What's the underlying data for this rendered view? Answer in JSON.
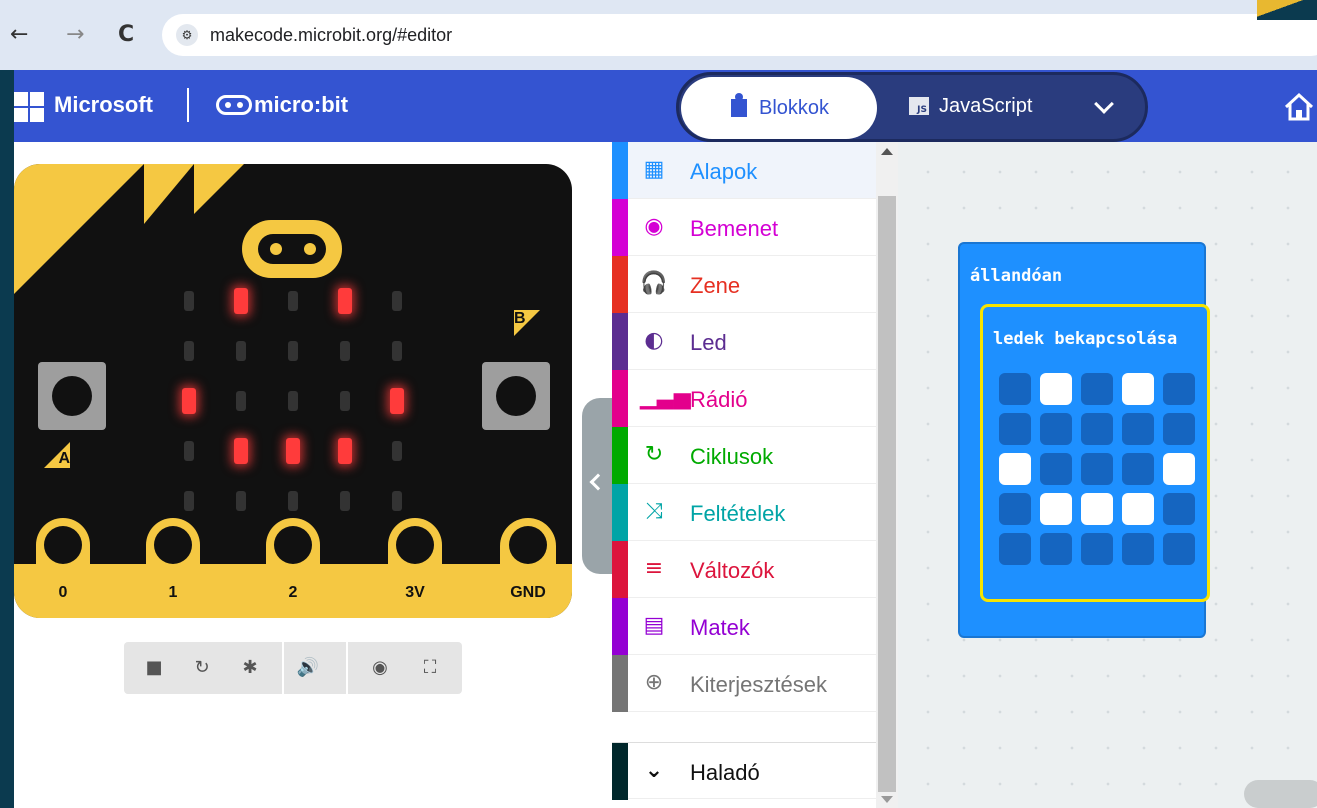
{
  "browser": {
    "back_glyph": "←",
    "forward_glyph": "→",
    "reload_glyph": "C",
    "site_info_glyph": "⚙",
    "url": "makecode.microbit.org/#editor"
  },
  "header": {
    "brand": "Microsoft",
    "product": "micro:bit",
    "tabs": {
      "blocks_label": "Blokkok",
      "js_label": "JavaScript",
      "js_badge": "JS"
    },
    "brand_colors": {
      "red": "#f25022",
      "green": "#7fba00",
      "blue": "#00a4ef",
      "yellow": "#ffb900"
    },
    "header_color": "#3454d1"
  },
  "simulator": {
    "button_a": "A",
    "button_b": "B",
    "pins": [
      "0",
      "1",
      "2",
      "3V",
      "GND"
    ],
    "led_matrix": [
      [
        0,
        1,
        0,
        1,
        0
      ],
      [
        0,
        0,
        0,
        0,
        0
      ],
      [
        1,
        0,
        0,
        0,
        1
      ],
      [
        0,
        1,
        1,
        1,
        0
      ],
      [
        0,
        0,
        0,
        0,
        0
      ]
    ],
    "controls": [
      {
        "name": "stop-icon",
        "glyph": "■"
      },
      {
        "name": "restart-icon",
        "glyph": "↻"
      },
      {
        "name": "debug-icon",
        "glyph": "✱"
      },
      {
        "name": "sound-icon",
        "glyph": "🔊"
      },
      {
        "name": "screenshot-icon",
        "glyph": "◉"
      },
      {
        "name": "fullscreen-icon",
        "glyph": "⛶"
      }
    ]
  },
  "toolbox": {
    "items": [
      {
        "label": "Alapok",
        "color": "#1e90ff",
        "icon": "grid-icon",
        "glyph": "▦"
      },
      {
        "label": "Bemenet",
        "color": "#d400d4",
        "icon": "target-icon",
        "glyph": "◉"
      },
      {
        "label": "Zene",
        "color": "#e63022",
        "icon": "headphones-icon",
        "glyph": "🎧"
      },
      {
        "label": "Led",
        "color": "#5c2d91",
        "icon": "toggle-icon",
        "glyph": "◐"
      },
      {
        "label": "Rádió",
        "color": "#e3008c",
        "icon": "signal-icon",
        "glyph": "▁▃▅"
      },
      {
        "label": "Ciklusok",
        "color": "#00aa00",
        "icon": "loop-icon",
        "glyph": "↻"
      },
      {
        "label": "Feltételek",
        "color": "#00a4a6",
        "icon": "shuffle-icon",
        "glyph": "⤨"
      },
      {
        "label": "Változók",
        "color": "#dc143c",
        "icon": "lines-icon",
        "glyph": "≡"
      },
      {
        "label": "Matek",
        "color": "#9400d3",
        "icon": "calculator-icon",
        "glyph": "▤"
      },
      {
        "label": "Kiterjesztések",
        "color": "#757575",
        "icon": "plus-circle-icon",
        "glyph": "⊕"
      }
    ],
    "advanced": {
      "label": "Haladó",
      "color": "#00272b",
      "glyph": "⌄"
    }
  },
  "workspace": {
    "forever_label": "állandóan",
    "show_leds_label": "ledek bekapcsolása",
    "leds": [
      [
        0,
        1,
        0,
        1,
        0
      ],
      [
        0,
        0,
        0,
        0,
        0
      ],
      [
        1,
        0,
        0,
        0,
        1
      ],
      [
        0,
        1,
        1,
        1,
        0
      ],
      [
        0,
        0,
        0,
        0,
        0
      ]
    ]
  }
}
